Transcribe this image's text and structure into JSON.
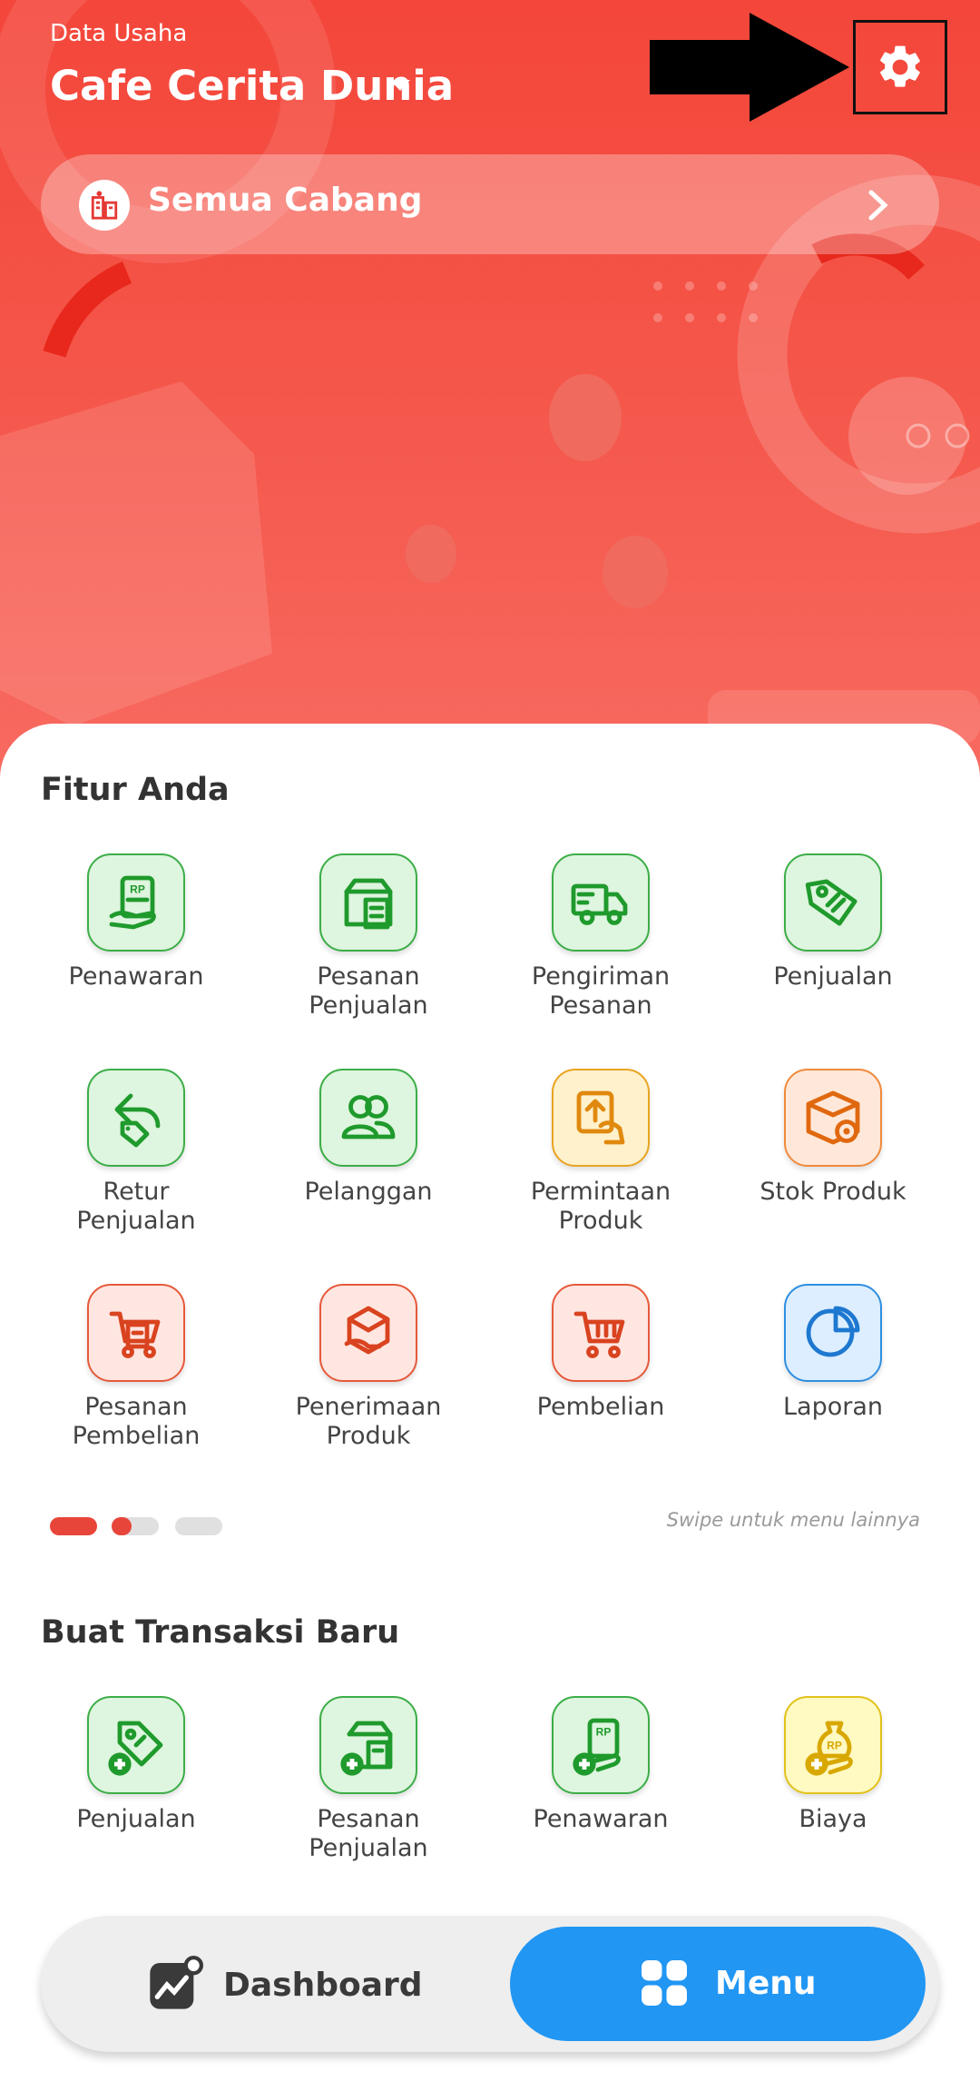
{
  "header": {
    "label": "Data Usaha",
    "business_name": "Cafe Cerita Dunia",
    "branch": "Semua Cabang"
  },
  "features": {
    "title": "Fitur Anda",
    "items": [
      {
        "label": "Penawaran",
        "color": "green",
        "icon": "quotation-icon"
      },
      {
        "label": "Pesanan Penjualan",
        "color": "green",
        "icon": "sales-order-icon"
      },
      {
        "label": "Pengiriman Pesanan",
        "color": "green",
        "icon": "delivery-truck-icon"
      },
      {
        "label": "Penjualan",
        "color": "green",
        "icon": "price-tag-icon"
      },
      {
        "label": "Retur Penjualan",
        "color": "green",
        "icon": "sales-return-icon"
      },
      {
        "label": "Pelanggan",
        "color": "green",
        "icon": "customers-icon"
      },
      {
        "label": "Permintaan Produk",
        "color": "yellow",
        "icon": "product-request-icon"
      },
      {
        "label": "Stok Produk",
        "color": "orange",
        "icon": "stock-box-icon"
      },
      {
        "label": "Pesanan Pembelian",
        "color": "red",
        "icon": "purchase-order-icon"
      },
      {
        "label": "Penerimaan Produk",
        "color": "red",
        "icon": "product-receipt-icon"
      },
      {
        "label": "Pembelian",
        "color": "red",
        "icon": "shopping-cart-icon"
      },
      {
        "label": "Laporan",
        "color": "blue",
        "icon": "pie-chart-icon"
      }
    ],
    "swipe_hint": "Swipe untuk menu lainnya",
    "pager": {
      "pages": 3,
      "active": 1
    }
  },
  "new_transaction": {
    "title": "Buat Transaksi Baru",
    "items": [
      {
        "label": "Penjualan",
        "color": "green",
        "icon": "add-sale-icon"
      },
      {
        "label": "Pesanan Penjualan",
        "color": "green",
        "icon": "add-sales-order-icon"
      },
      {
        "label": "Penawaran",
        "color": "green",
        "icon": "add-quotation-icon"
      },
      {
        "label": "Biaya",
        "color": "lemon",
        "icon": "add-expense-icon"
      }
    ]
  },
  "nav": {
    "dashboard": "Dashboard",
    "menu": "Menu",
    "active": "menu"
  },
  "colors": {
    "brand_red": "#f4463a",
    "accent_blue": "#2196f3",
    "icon_green": "#1f9a2c",
    "icon_orange": "#e0680f",
    "icon_red": "#d9431f",
    "icon_blue": "#1e78d0"
  }
}
